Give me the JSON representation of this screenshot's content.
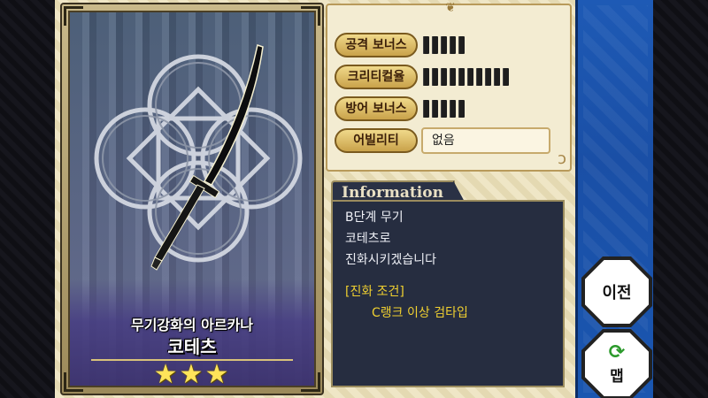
{
  "card": {
    "subtitle": "무기강화의 아르카나",
    "name": "코테츠",
    "stars": "★★★"
  },
  "stats": {
    "attack_label": "공격 보너스",
    "attack_level": 5,
    "critical_label": "크리티컬율",
    "critical_level": 10,
    "defense_label": "방어 보너스",
    "defense_level": 5,
    "ability_label": "어빌리티",
    "ability_value": "없음"
  },
  "info": {
    "tab_title": "Information",
    "lines": [
      "B단계 무기",
      "코테츠로",
      "진화시키겠습니다"
    ],
    "condition_title": "[진화 조건]",
    "condition_text": "C랭크 이상 검타입"
  },
  "buttons": {
    "prev_label": "이전",
    "map_label": "맵",
    "map_icon": "refresh-icon"
  },
  "colors": {
    "info_bg": "#262d40",
    "condition_text": "#f0d030",
    "right_column": "#1a4fa6",
    "star": "#ffe45a"
  }
}
